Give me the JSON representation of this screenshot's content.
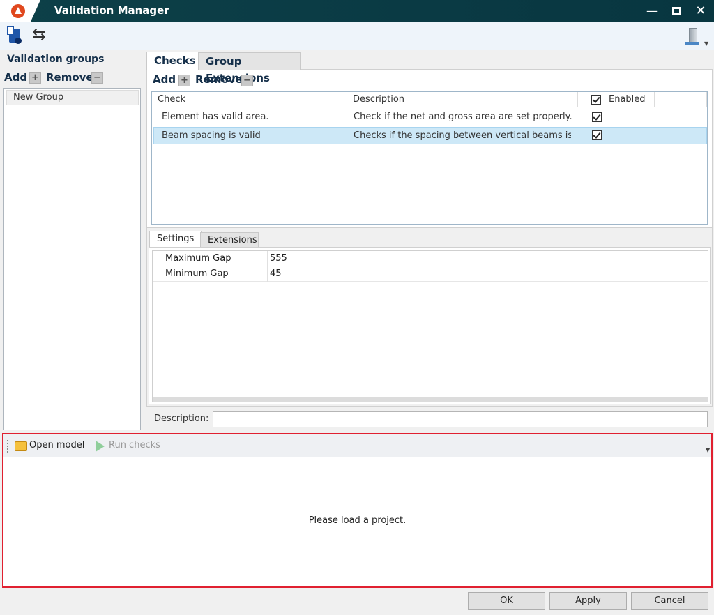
{
  "window": {
    "title": "Validation Manager"
  },
  "left": {
    "header": "Validation groups",
    "add_label": "Add",
    "remove_label": "Remove",
    "groups": [
      "New Group"
    ]
  },
  "tabs_top": [
    "Checks",
    "Group Extensions"
  ],
  "checks": {
    "add_label": "Add",
    "remove_label": "Remove",
    "columns": {
      "check": "Check",
      "description": "Description",
      "enabled": "Enabled"
    },
    "rows": [
      {
        "check": "Element has valid area.",
        "description": "Check if the net and gross area are set properly."
      },
      {
        "check": "Beam spacing is valid",
        "description": "Checks if the spacing between vertical beams is wit"
      }
    ]
  },
  "tabs_bottom": [
    "Settings",
    "Extensions"
  ],
  "settings": {
    "rows": [
      {
        "name": "Maximum Gap",
        "value": "555"
      },
      {
        "name": "Minimum Gap",
        "value": "45"
      }
    ]
  },
  "description_label": "Description:",
  "bottom": {
    "open_model": "Open model",
    "run_checks": "Run checks",
    "message": "Please load a project."
  },
  "buttons": {
    "ok": "OK",
    "apply": "Apply",
    "cancel": "Cancel"
  },
  "colors": {
    "titlebar": "#0d4048",
    "selection": "#cde8f7",
    "highlight_border": "#e02030"
  }
}
